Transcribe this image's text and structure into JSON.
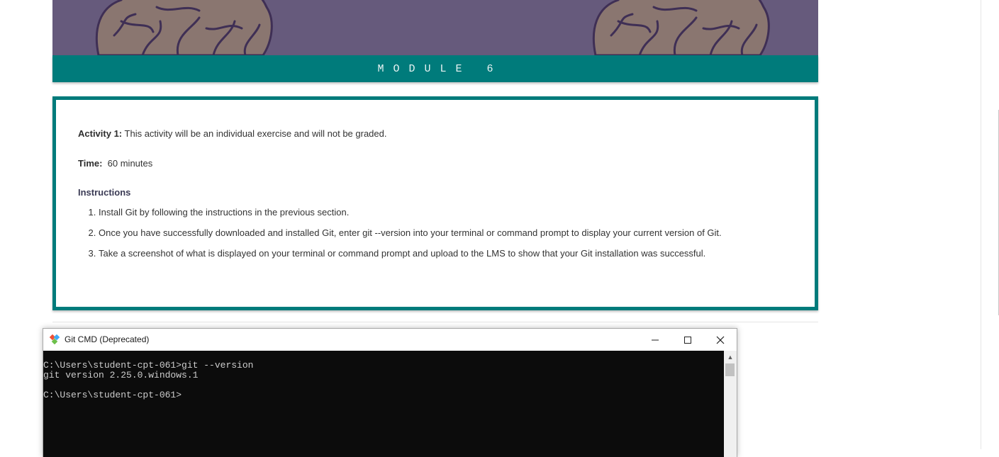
{
  "banner": {
    "module_label": "MODULE 6"
  },
  "activity": {
    "title_label": "Activity 1:",
    "title_text": " This activity will be an individual exercise and will not be graded.",
    "time_label": "Time:",
    "time_value": "  60 minutes",
    "instructions_heading": "Instructions",
    "steps": [
      "Install Git by following the instructions in the previous section.",
      "Once you have successfully downloaded and installed Git, enter git --version into your terminal or command prompt to display your current version of Git.",
      "Take a screenshot of what is displayed on your terminal or command prompt and upload to the LMS to show that your Git installation was successful."
    ]
  },
  "window": {
    "title": "Git CMD (Deprecated)",
    "console_lines": [
      "C:\\Users\\student-cpt-061>git --version",
      "git version 2.25.0.windows.1",
      "",
      "C:\\Users\\student-cpt-061>"
    ]
  },
  "colors": {
    "teal": "#007b7b",
    "banner_purple": "#665a7c",
    "brain": "#8a7670",
    "console_bg": "#0c0c0c"
  }
}
